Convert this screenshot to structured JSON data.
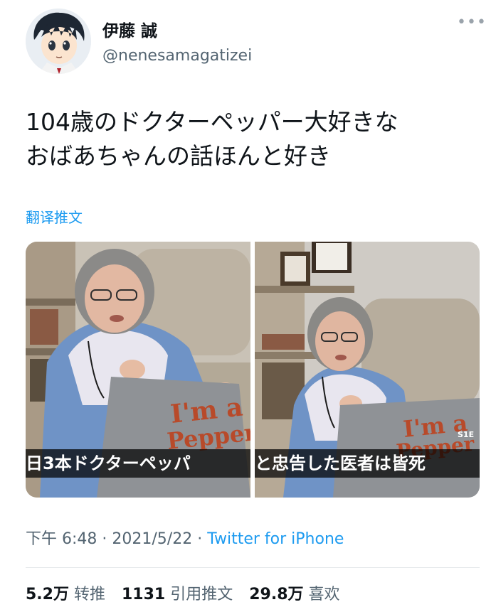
{
  "user": {
    "display_name": "伊藤 誠",
    "handle": "@nenesamagatizei"
  },
  "tweet": {
    "line1": "104歳のドクターペッパー大好きな",
    "line2": "おばあちゃんの話ほんと好き",
    "translate_label": "翻译推文"
  },
  "media": {
    "left_caption": "日3本ドクターペッパ",
    "right_caption": "と忠告した医者は皆死",
    "shirt_text_1": "I'm a",
    "shirt_text_2": "Pepper",
    "tag_text": "S1E"
  },
  "meta": {
    "time": "下午 6:48",
    "separator": " · ",
    "date": "2021/5/22",
    "source": "Twitter for iPhone"
  },
  "stats": {
    "retweets_count": "5.2万",
    "retweets_label": "转推",
    "quotes_count": "1131",
    "quotes_label": "引用推文",
    "likes_count": "29.8万",
    "likes_label": "喜欢"
  },
  "icons": {
    "more": "more-dots-icon"
  }
}
